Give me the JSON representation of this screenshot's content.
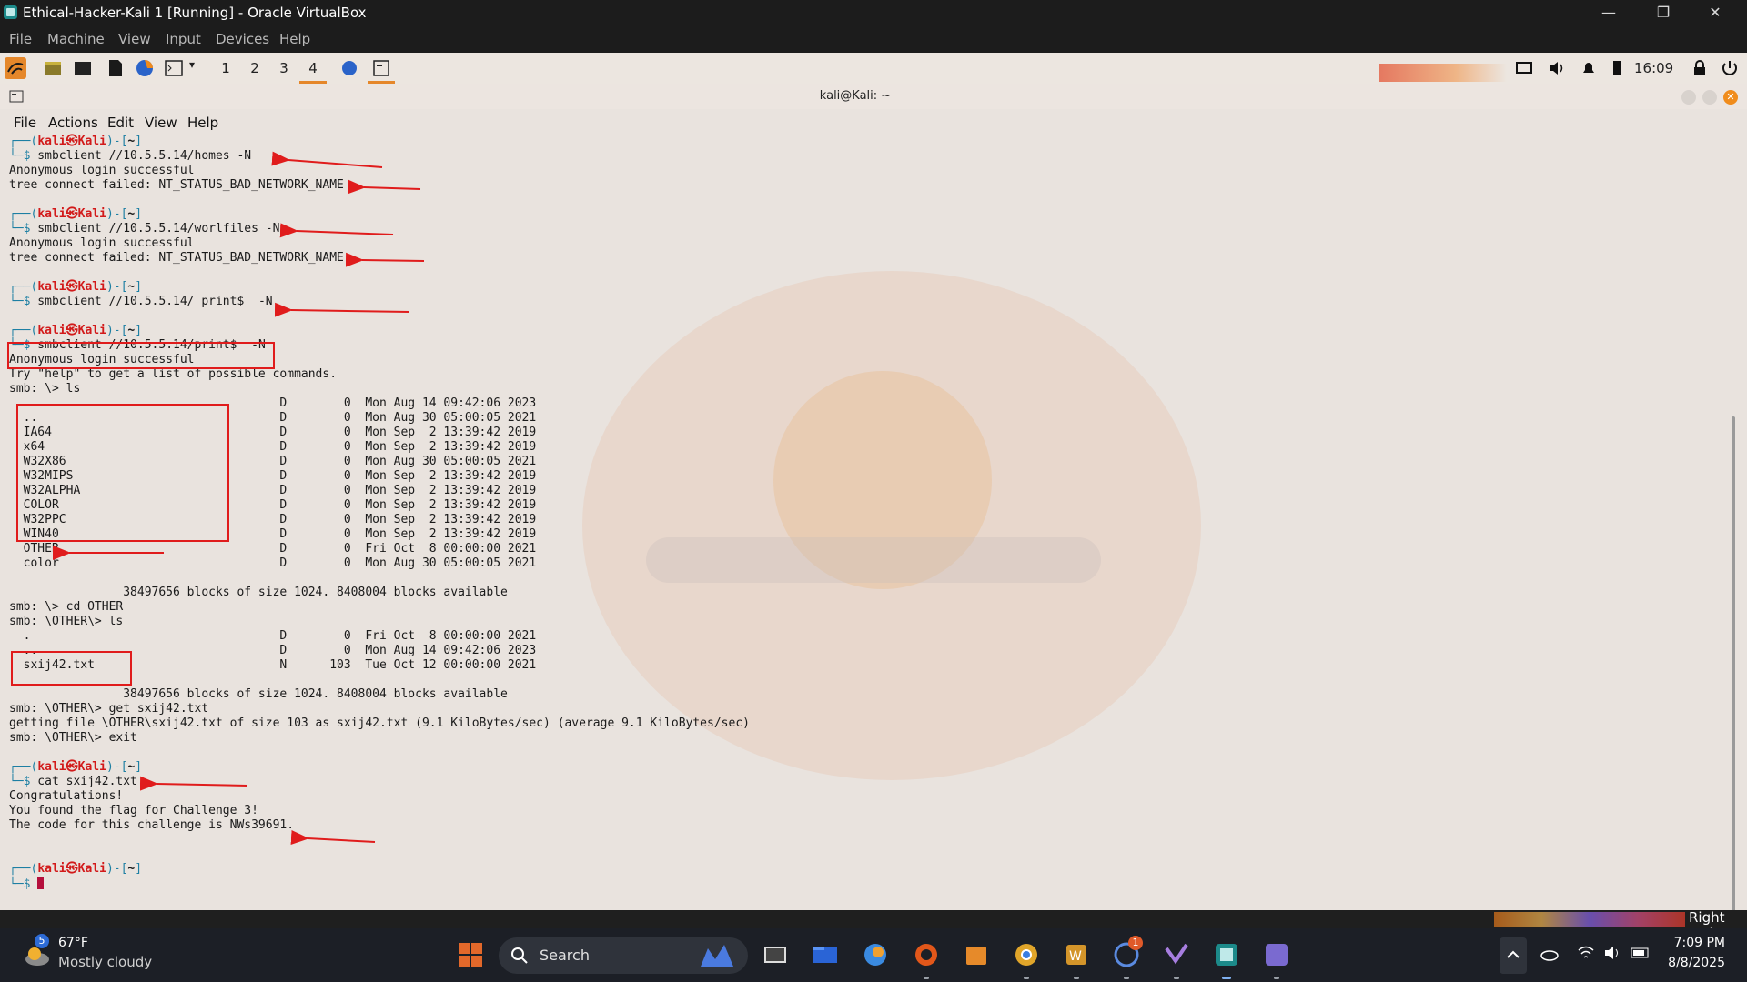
{
  "vbox": {
    "title": "Ethical-Hacker-Kali 1 [Running] - Oracle VirtualBox",
    "menu": [
      "File",
      "Machine",
      "View",
      "Input",
      "Devices",
      "Help"
    ],
    "host_key": "Right Ctrl",
    "window_controls": {
      "minimize": "—",
      "restore": "❐",
      "close": "✕"
    }
  },
  "kali_panel": {
    "workspaces": [
      "1",
      "2",
      "3",
      "4"
    ],
    "active_workspace": "4",
    "clock": "16:09",
    "icons": [
      "kali-menu-icon",
      "show-desktop-icon",
      "file-manager-icon",
      "terminal-icon",
      "text-editor-icon",
      "firefox-icon",
      "terminal-panel-icon",
      "screen-icon",
      "volume-icon",
      "notification-bell-icon",
      "battery-icon",
      "lock-icon",
      "power-icon"
    ]
  },
  "terminal": {
    "title": "kali@Kali: ~",
    "menu": [
      "File",
      "Actions",
      "Edit",
      "View",
      "Help"
    ],
    "prompt": {
      "open": "┌──(",
      "user": "kali",
      "at": "㉿",
      "host": "Kali",
      "close": ")-[",
      "path": "~",
      "end": "]",
      "dollar": "└─$"
    },
    "lines": [
      {
        "k": "prompt"
      },
      {
        "k": "cmd",
        "t": " smbclient //10.5.5.14/homes -N"
      },
      {
        "k": "out",
        "t": "Anonymous login successful"
      },
      {
        "k": "out",
        "t": "tree connect failed: NT_STATUS_BAD_NETWORK_NAME"
      },
      {
        "k": "blank"
      },
      {
        "k": "prompt"
      },
      {
        "k": "cmd",
        "t": " smbclient //10.5.5.14/worlfiles -N"
      },
      {
        "k": "out",
        "t": "Anonymous login successful"
      },
      {
        "k": "out",
        "t": "tree connect failed: NT_STATUS_BAD_NETWORK_NAME"
      },
      {
        "k": "blank"
      },
      {
        "k": "prompt"
      },
      {
        "k": "cmd",
        "t": " smbclient //10.5.5.14/ print$  -N"
      },
      {
        "k": "blank"
      },
      {
        "k": "prompt"
      },
      {
        "k": "cmd",
        "t": " smbclient //10.5.5.14/print$  -N"
      },
      {
        "k": "out",
        "t": "Anonymous login successful"
      },
      {
        "k": "out",
        "t": "Try \"help\" to get a list of possible commands."
      },
      {
        "k": "out",
        "t": "smb: \\> ls"
      },
      {
        "k": "out",
        "t": "  .                                   D        0  Mon Aug 14 09:42:06 2023"
      },
      {
        "k": "out",
        "t": "  ..                                  D        0  Mon Aug 30 05:00:05 2021"
      },
      {
        "k": "out",
        "t": "  IA64                                D        0  Mon Sep  2 13:39:42 2019"
      },
      {
        "k": "out",
        "t": "  x64                                 D        0  Mon Sep  2 13:39:42 2019"
      },
      {
        "k": "out",
        "t": "  W32X86                              D        0  Mon Aug 30 05:00:05 2021"
      },
      {
        "k": "out",
        "t": "  W32MIPS                             D        0  Mon Sep  2 13:39:42 2019"
      },
      {
        "k": "out",
        "t": "  W32ALPHA                            D        0  Mon Sep  2 13:39:42 2019"
      },
      {
        "k": "out",
        "t": "  COLOR                               D        0  Mon Sep  2 13:39:42 2019"
      },
      {
        "k": "out",
        "t": "  W32PPC                              D        0  Mon Sep  2 13:39:42 2019"
      },
      {
        "k": "out",
        "t": "  WIN40                               D        0  Mon Sep  2 13:39:42 2019"
      },
      {
        "k": "out",
        "t": "  OTHER                               D        0  Fri Oct  8 00:00:00 2021"
      },
      {
        "k": "out",
        "t": "  color                               D        0  Mon Aug 30 05:00:05 2021"
      },
      {
        "k": "blank"
      },
      {
        "k": "out",
        "t": "                38497656 blocks of size 1024. 8408004 blocks available"
      },
      {
        "k": "out",
        "t": "smb: \\> cd OTHER"
      },
      {
        "k": "out",
        "t": "smb: \\OTHER\\> ls"
      },
      {
        "k": "out",
        "t": "  .                                   D        0  Fri Oct  8 00:00:00 2021"
      },
      {
        "k": "out",
        "t": "  ..                                  D        0  Mon Aug 14 09:42:06 2023"
      },
      {
        "k": "out",
        "t": "  sxij42.txt                          N      103  Tue Oct 12 00:00:00 2021"
      },
      {
        "k": "blank"
      },
      {
        "k": "out",
        "t": "                38497656 blocks of size 1024. 8408004 blocks available"
      },
      {
        "k": "out",
        "t": "smb: \\OTHER\\> get sxij42.txt"
      },
      {
        "k": "out",
        "t": "getting file \\OTHER\\sxij42.txt of size 103 as sxij42.txt (9.1 KiloBytes/sec) (average 9.1 KiloBytes/sec)"
      },
      {
        "k": "out",
        "t": "smb: \\OTHER\\> exit"
      },
      {
        "k": "blank"
      },
      {
        "k": "prompt"
      },
      {
        "k": "cmd",
        "t": " cat sxij42.txt"
      },
      {
        "k": "out",
        "t": "Congratulations!"
      },
      {
        "k": "out",
        "t": "You found the flag for Challenge 3!"
      },
      {
        "k": "out",
        "t": "The code for this challenge is NWs39691."
      },
      {
        "k": "blank"
      },
      {
        "k": "blank"
      },
      {
        "k": "prompt"
      },
      {
        "k": "cmd_cursor",
        "t": " "
      }
    ]
  },
  "tray_flyout": [
    "snipping-tool-icon",
    "hotspot-icon",
    "teams-icon",
    "bluetooth-icon",
    "security-icon"
  ],
  "taskbar": {
    "weather": {
      "badge": "5",
      "temp": "67°F",
      "desc": "Mostly cloudy"
    },
    "search_label": "Search",
    "apps": [
      "start-icon",
      "search-icon",
      "task-view-icon",
      "file-explorer-icon",
      "copilot-icon",
      "edge-icon",
      "store-icon",
      "chrome-icon",
      "word-icon",
      "whatsapp-icon",
      "visual-studio-icon",
      "virtualbox-icon",
      "snipping-icon"
    ],
    "whatsapp_badge": "1",
    "time": "7:09 PM",
    "date": "8/8/2025"
  },
  "colors": {
    "annotation_red": "#e01c1c",
    "prompt_blue": "#1d7fa3",
    "prompt_user_red": "#d21a1a"
  }
}
